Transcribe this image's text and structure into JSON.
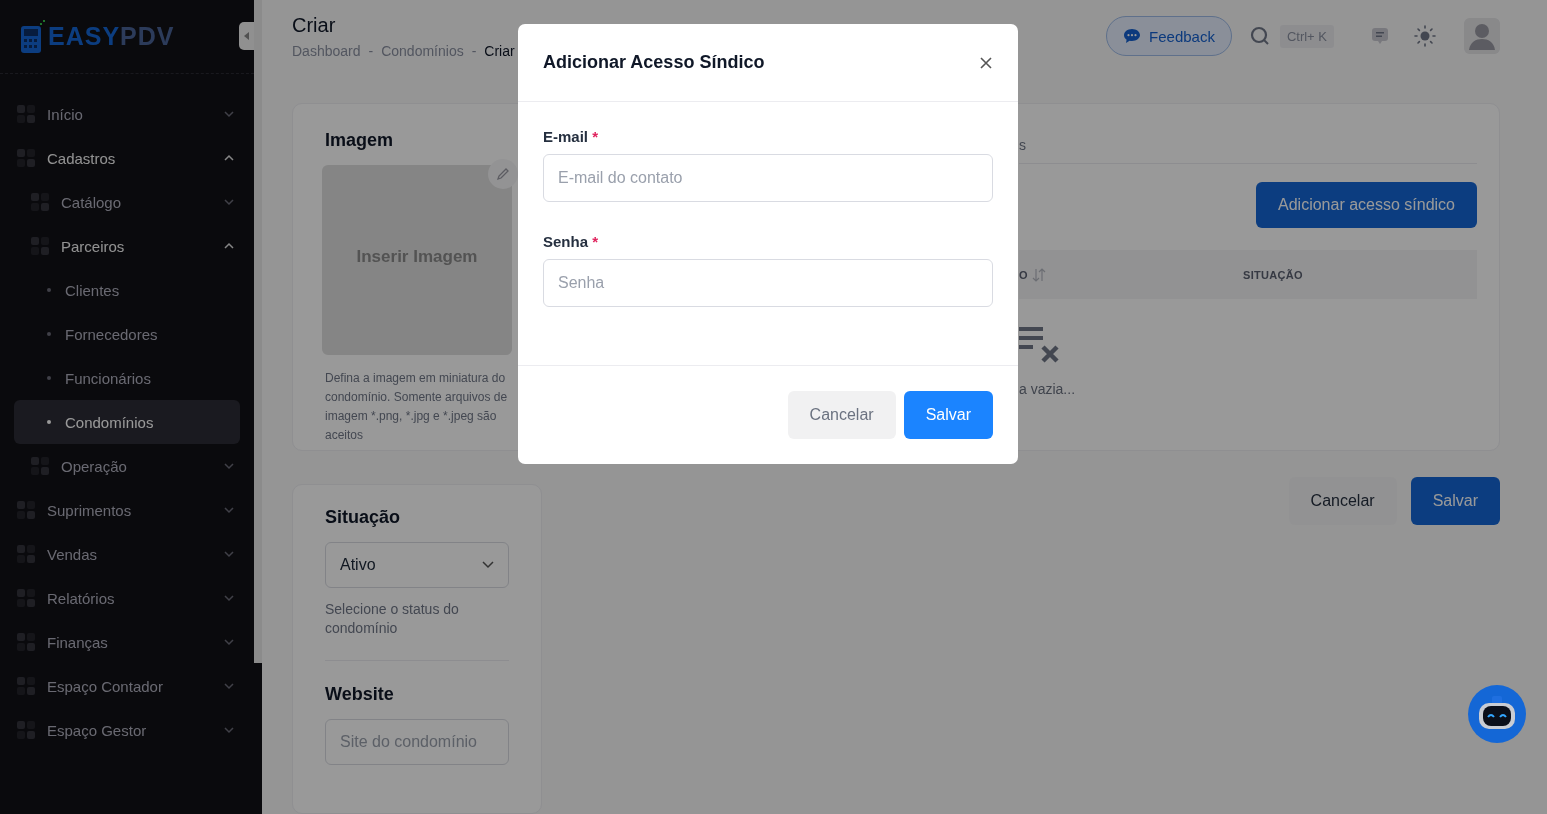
{
  "logo": {
    "first": "EASY",
    "second": "PDV"
  },
  "sidebar": {
    "items": [
      {
        "label": "Início",
        "expanded": false,
        "selected": false
      },
      {
        "label": "Cadastros",
        "expanded": true,
        "selected": false,
        "children": [
          {
            "label": "Catálogo",
            "expanded": false,
            "selected": false
          },
          {
            "label": "Parceiros",
            "expanded": true,
            "selected": false,
            "children": [
              {
                "label": "Clientes",
                "selected": false
              },
              {
                "label": "Fornecedores",
                "selected": false
              },
              {
                "label": "Funcionários",
                "selected": false
              },
              {
                "label": "Condomínios",
                "selected": true
              }
            ]
          },
          {
            "label": "Operação",
            "expanded": false,
            "selected": false
          }
        ]
      },
      {
        "label": "Suprimentos",
        "expanded": false,
        "selected": false
      },
      {
        "label": "Vendas",
        "expanded": false,
        "selected": false
      },
      {
        "label": "Relatórios",
        "expanded": false,
        "selected": false
      },
      {
        "label": "Finanças",
        "expanded": false,
        "selected": false
      },
      {
        "label": "Espaço Contador",
        "expanded": false,
        "selected": false
      },
      {
        "label": "Espaço Gestor",
        "expanded": false,
        "selected": false
      }
    ]
  },
  "header": {
    "title": "Criar",
    "separator": "-",
    "breadcrumb": [
      "Dashboard",
      "Condomínios",
      "Criar"
    ]
  },
  "topbar": {
    "feedback": "Feedback",
    "shortcut": "Ctrl+ K"
  },
  "image_card": {
    "title": "Imagem",
    "placeholder_text": "Inserir Imagem",
    "help": "Defina a imagem em miniatura do condomínio. Somente arquivos de imagem *.png, *.jpg e *.jpeg são aceitos"
  },
  "status_card": {
    "title": "Situação",
    "select_value": "Ativo",
    "help": "Selecione o status do condomínio",
    "website_title": "Website",
    "website_placeholder": "Site do condomínio"
  },
  "access_card": {
    "tab_fragment": "s",
    "add_button": "Adicionar acesso síndico",
    "columns": [
      "O",
      "SITUAÇÃO"
    ],
    "empty_fragment": "a vazia..."
  },
  "actions": {
    "cancel": "Cancelar",
    "save": "Salvar"
  },
  "modal": {
    "title": "Adicionar Acesso Síndico",
    "fields": [
      {
        "label": "E-mail",
        "required_mark": "*",
        "placeholder": "E-mail do contato"
      },
      {
        "label": "Senha",
        "required_mark": "*",
        "placeholder": "Senha"
      }
    ],
    "cancel": "Cancelar",
    "save": "Salvar"
  }
}
